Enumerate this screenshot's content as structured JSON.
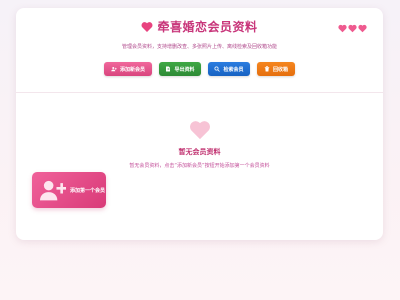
{
  "header": {
    "title": "牵喜婚恋会员资料",
    "subtitle": "管理会员资料，支持增删改查、多张照片上传、离线检索及回收箱功能"
  },
  "toolbar": {
    "add_label": "添加新会员",
    "export_label": "导出资料",
    "search_label": "检索会员",
    "print_label": "回收箱"
  },
  "empty_state": {
    "title": "暂无会员资料",
    "description": "暂无会员资料，点击“添加新会员”按钮开始添加第一个会员资料"
  },
  "add_first": {
    "label": "添加第一个会员"
  },
  "colors": {
    "brand": "#c8357a",
    "add": "#e1508a",
    "export": "#38a040",
    "search": "#1f70d2",
    "print": "#f07a18"
  },
  "icons": [
    "heart-icon",
    "user-plus-icon",
    "export-icon",
    "search-icon",
    "trash-icon"
  ]
}
